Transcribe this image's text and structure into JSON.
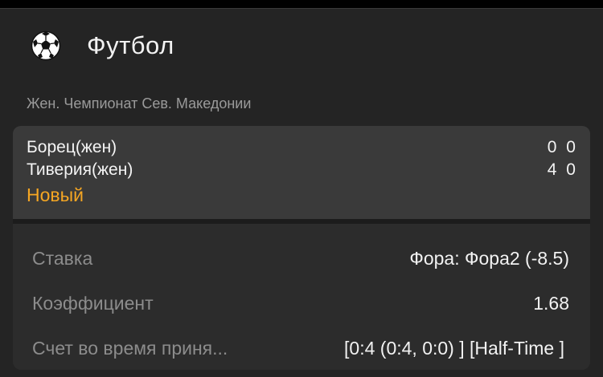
{
  "header": {
    "sport_icon": "soccer-ball-icon",
    "sport_title": "Футбол"
  },
  "league": "Жен. Чемпионат Сев. Македонии",
  "event": {
    "team_home": "Борец(жен)",
    "team_away": "Тиверия(жен)",
    "score_home": "0 0",
    "score_away": "4 0",
    "status": "Новый"
  },
  "details": [
    {
      "label": "Ставка",
      "value": "Фора: Фора2 (-8.5)"
    },
    {
      "label": "Коэффициент",
      "value": "1.68"
    },
    {
      "label": "Счет во время приня...",
      "value": "[0:4 (0:4, 0:0) ] [Half-Time ]"
    }
  ],
  "colors": {
    "status": "#f5a623",
    "background": "#242424",
    "card": "#2c2c2c",
    "event_block": "#3a3a3a"
  }
}
